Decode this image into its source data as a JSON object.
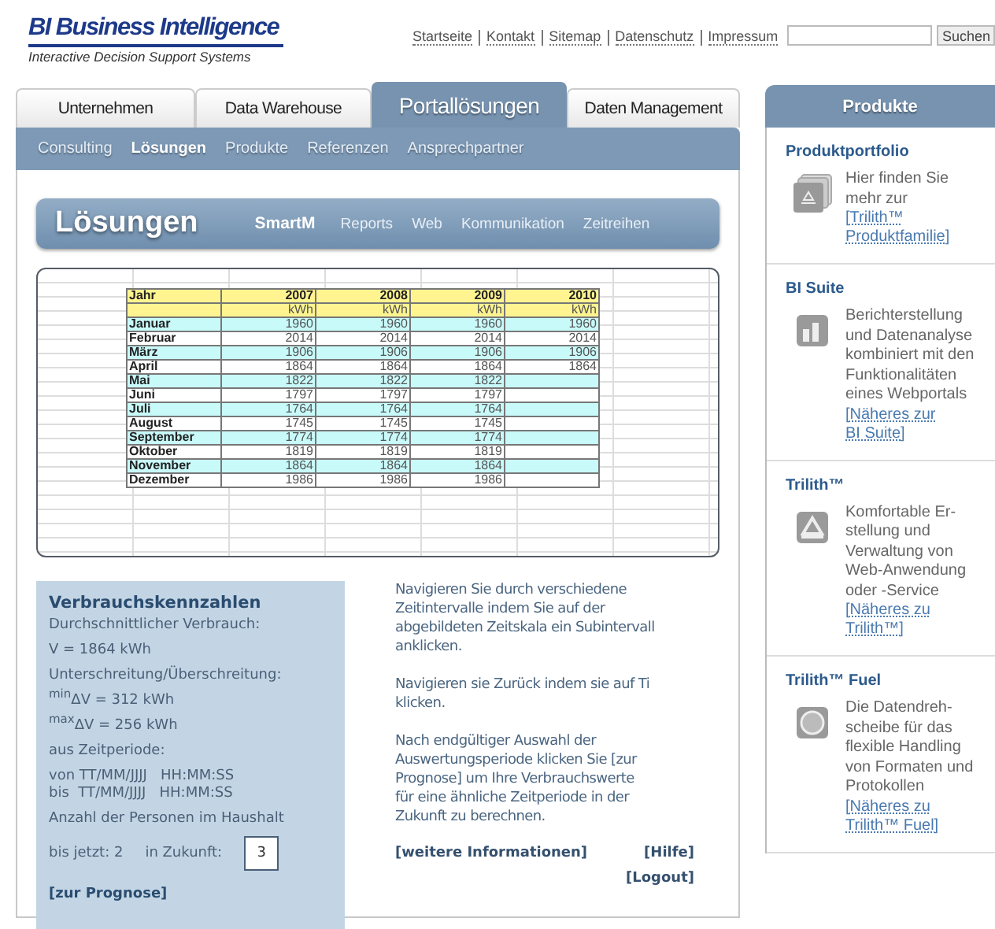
{
  "header": {
    "logo": "BI Business Intelligence",
    "tagline": "Interactive Decision Support Systems",
    "top_links": [
      "Startseite",
      "Kontakt",
      "Sitemap",
      "Datenschutz",
      "Impressum"
    ],
    "search_button": "Suchen"
  },
  "tabs": [
    {
      "label": "Unternehmen",
      "selected": false
    },
    {
      "label": "Data Warehouse",
      "selected": false
    },
    {
      "label": "Portallösungen",
      "selected": true
    },
    {
      "label": "Daten Management",
      "selected": false
    }
  ],
  "subnav": [
    {
      "label": "Consulting",
      "selected": false
    },
    {
      "label": "Lösungen",
      "selected": true
    },
    {
      "label": "Produkte",
      "selected": false
    },
    {
      "label": "Referenzen",
      "selected": false
    },
    {
      "label": "Ansprechpartner",
      "selected": false
    }
  ],
  "section": {
    "title": "Lösungen",
    "items": [
      {
        "label": "SmartM",
        "selected": true
      },
      {
        "label": "Reports",
        "selected": false
      },
      {
        "label": "Web",
        "selected": false
      },
      {
        "label": "Kommunikation",
        "selected": false
      },
      {
        "label": "Zeitreihen",
        "selected": false
      }
    ]
  },
  "table": {
    "columns": [
      "Jahr",
      "2007",
      "2008",
      "2009",
      "2010"
    ],
    "units": [
      "kWh",
      "kWh",
      "kWh",
      "kWh"
    ],
    "rows": [
      {
        "month": "Januar",
        "values": [
          "1960",
          "1960",
          "1960",
          "1960"
        ]
      },
      {
        "month": "Februar",
        "values": [
          "2014",
          "2014",
          "2014",
          "2014"
        ]
      },
      {
        "month": "März",
        "values": [
          "1906",
          "1906",
          "1906",
          "1906"
        ]
      },
      {
        "month": "April",
        "values": [
          "1864",
          "1864",
          "1864",
          "1864"
        ]
      },
      {
        "month": "Mai",
        "values": [
          "1822",
          "1822",
          "1822"
        ]
      },
      {
        "month": "Juni",
        "values": [
          "1797",
          "1797",
          "1797"
        ]
      },
      {
        "month": "Juli",
        "values": [
          "1764",
          "1764",
          "1764"
        ]
      },
      {
        "month": "August",
        "values": [
          "1745",
          "1745",
          "1745"
        ]
      },
      {
        "month": "September",
        "values": [
          "1774",
          "1774",
          "1774"
        ]
      },
      {
        "month": "Oktober",
        "values": [
          "1819",
          "1819",
          "1819"
        ]
      },
      {
        "month": "November",
        "values": [
          "1864",
          "1864",
          "1864"
        ]
      },
      {
        "month": "Dezember",
        "values": [
          "1986",
          "1986",
          "1986"
        ]
      }
    ]
  },
  "kennzahlen": {
    "title": "Verbrauchskennzahlen",
    "lines": [
      "Durchschnittlicher Verbrauch:",
      "V = 1864 kWh",
      "Unterschreitung/Überschreitung:\n$^{min}$ΔV = 312 kWh\n$^{max}$ΔV = 256 kWh",
      "aus Zeitperiode:",
      "von TT/MM/JJJJ   HH:MM:SS\nbis  TT/MM/JJJJ   HH:MM:SS",
      "Anzahl der Personen im Haushalt"
    ],
    "bisher": "bis jetzt: 2",
    "zukunft_label": "in Zukunft:",
    "zukunft_value": "3",
    "link": "[zur Prognose]"
  },
  "hinweise": {
    "paragraphs": [
      "Navigieren Sie durch verschiedene\nZeitintervalle indem Sie auf der\nabgebildeten Zeitskala ein Subintervall\nanklicken.",
      "Navigieren sie Zurück indem sie auf Ti\nklicken.",
      "Nach endgültiger Auswahl der\nAuswertungsperiode klicken Sie [zur\nPrognose] um Ihre Verbrauchswerte\nfür eine ähnliche Zeitperiode in der\nZukunft zu berechnen."
    ],
    "more_link": "[weitere Informationen]",
    "help_link": "[Hilfe]",
    "logout_link": "[Logout]"
  },
  "sidebar": {
    "title": "Produkte",
    "products": [
      {
        "kind": "stack",
        "title": "Produktportfolio",
        "text": "Hier finden Sie\nmehr zur",
        "link": "[Trilith™\nProduktfamilie]"
      },
      {
        "kind": "chart",
        "title": "BI Suite",
        "text": "Berichterstellung\nund Datenanalyse\nkombiniert mit den\nFunktionalitäten\neines Webportals",
        "link": "[Näheres zur\nBI Suite]"
      },
      {
        "kind": "letter",
        "title": "Trilith™",
        "text": "Komfortable Er-\nstellung und\nVerwaltung von\nWeb-Anwendung\noder -Service",
        "link": "[Näheres zu\nTrilith™]"
      },
      {
        "kind": "circle",
        "title": "Trilith™ Fuel",
        "text": "Die Datendreh-\nscheibe für das\nflexible Handling\nvon Formaten und\nProtokollen",
        "link": "[Näheres zu\nTrilith™ Fuel]"
      }
    ]
  }
}
